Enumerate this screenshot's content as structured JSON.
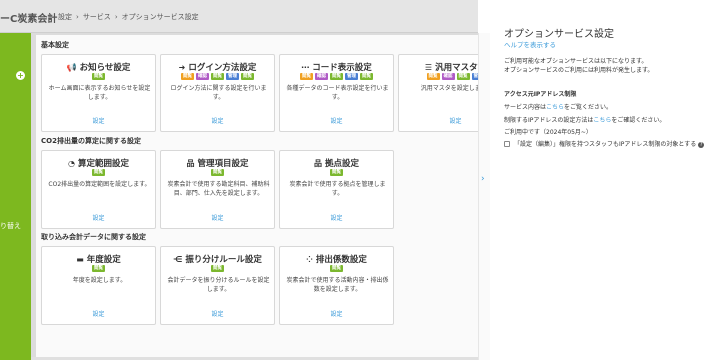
{
  "app": {
    "title": "ーC炭素会計"
  },
  "breadcrumb": [
    "設定",
    "サービス",
    "オプションサービス設定"
  ],
  "sidebar": {
    "plus_icon": "plus-circle-icon",
    "label": "り替え"
  },
  "sections": [
    {
      "title": "基本設定",
      "cards": [
        {
          "title": "お知らせ設定",
          "icon": "megaphone-icon",
          "glyph": "📢",
          "badges": [
            {
              "label": "閲覧",
              "color": "#7cb82f"
            }
          ],
          "desc": "ホーム画面に表示するお知らせを設定します。",
          "link": "設定"
        },
        {
          "title": "ログイン方法設定",
          "icon": "login-icon",
          "glyph": "➜",
          "badges": [
            {
              "label": "閲覧",
              "color": "#f0a020"
            },
            {
              "label": "確認",
              "color": "#b05bc6"
            },
            {
              "label": "閲覧",
              "color": "#7cb82f"
            },
            {
              "label": "管理",
              "color": "#4a7fd4"
            },
            {
              "label": "閲覧",
              "color": "#7cb82f"
            }
          ],
          "desc": "ログイン方法に関する設定を行います。",
          "link": "設定"
        },
        {
          "title": "コード表示設定",
          "icon": "code-icon",
          "glyph": "⋯",
          "badges": [
            {
              "label": "閲覧",
              "color": "#f0a020"
            },
            {
              "label": "確認",
              "color": "#b05bc6"
            },
            {
              "label": "閲覧",
              "color": "#7cb82f"
            },
            {
              "label": "管理",
              "color": "#4a7fd4"
            },
            {
              "label": "閲覧",
              "color": "#7cb82f"
            }
          ],
          "desc": "各種データのコード表示設定を行います。",
          "link": "設定"
        },
        {
          "title": "汎用マスタ設",
          "icon": "list-icon",
          "glyph": "☰",
          "badges": [
            {
              "label": "閲覧",
              "color": "#f0a020"
            },
            {
              "label": "確認",
              "color": "#b05bc6"
            },
            {
              "label": "閲覧",
              "color": "#7cb82f"
            },
            {
              "label": "管理",
              "color": "#4a7fd4"
            }
          ],
          "desc": "汎用マスタを設定します。",
          "link": "設定"
        }
      ]
    },
    {
      "title": "CO2排出量の算定に関する設定",
      "cards": [
        {
          "title": "算定範囲設定",
          "icon": "pie-chart-icon",
          "glyph": "◔",
          "badges": [
            {
              "label": "閲覧",
              "color": "#7cb82f"
            }
          ],
          "desc": "CO2排出量の算定範囲を設定します。",
          "link": "設定"
        },
        {
          "title": "管理項目設定",
          "icon": "hierarchy-icon",
          "glyph": "品",
          "badges": [
            {
              "label": "閲覧",
              "color": "#7cb82f"
            }
          ],
          "desc": "炭素会計で使用する勘定科目、補助科目、部門、仕入先を設定します。",
          "link": "設定"
        },
        {
          "title": "拠点設定",
          "icon": "location-icon",
          "glyph": "品",
          "badges": [
            {
              "label": "閲覧",
              "color": "#7cb82f"
            }
          ],
          "desc": "炭素会計で使用する拠点を管理します。",
          "link": "設定"
        }
      ]
    },
    {
      "title": "取り込み会計データに関する設定",
      "cards": [
        {
          "title": "年度設定",
          "icon": "calendar-icon",
          "glyph": "▬",
          "badges": [
            {
              "label": "閲覧",
              "color": "#7cb82f"
            }
          ],
          "desc": "年度を設定します。",
          "link": "設定"
        },
        {
          "title": "振り分けルール設定",
          "icon": "split-icon",
          "glyph": "⋲",
          "badges": [
            {
              "label": "閲覧",
              "color": "#7cb82f"
            }
          ],
          "desc": "会計データを振り分けるルールを設定します。",
          "link": "設定"
        },
        {
          "title": "排出係数設定",
          "icon": "grid-icon",
          "glyph": "⁘",
          "badges": [
            {
              "label": "閲覧",
              "color": "#7cb82f"
            }
          ],
          "desc": "炭素会計で使用する活動内容・排出係数を設定します。",
          "link": "設定"
        }
      ]
    }
  ],
  "panel": {
    "collapse_icon": "chevron-right-icon",
    "title": "オプションサービス設定",
    "help_link": "ヘルプを表示する",
    "intro1": "ご利用可能なオプションサービスは以下になります。",
    "intro2": "オプションサービスのご利用には利用料が発生します。",
    "access_heading": "アクセス元IPアドレス制限",
    "service_prefix": "サービス内容は",
    "service_link": "こちら",
    "service_suffix": "をご覧ください。",
    "ip_prefix": "制限するIPアドレスの設定方法は",
    "ip_link": "こちら",
    "ip_suffix": "をご確認ください。",
    "status": "ご利用中です（2024年05月~）",
    "checkbox_label": "「設定（編集）」権限を持つスタッフもIPアドレス制限の対象とする"
  }
}
